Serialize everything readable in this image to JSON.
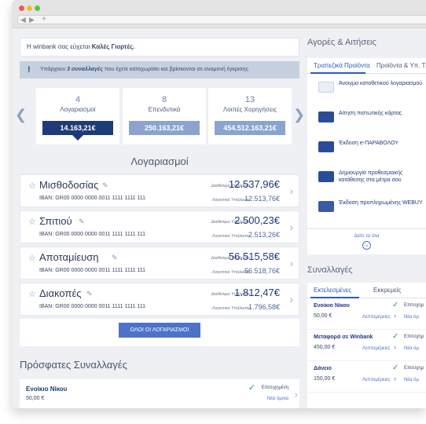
{
  "welcome": {
    "prefix": "Η winbank σας εύχεται ",
    "bold": "Καλές Γιορτές."
  },
  "notice": {
    "icon": "!",
    "before": "Υπάρχουν ",
    "bold": "3 συναλλαγές",
    "after": " που έχετε καταχωρίσει και βρίσκονται σε αναμονή έγκρισης"
  },
  "summary_cards": [
    {
      "count": "4",
      "label": "Λογαριασμοί",
      "value": "14.163,21€",
      "active": true
    },
    {
      "count": "8",
      "label": "Επενδυτικά",
      "value": "250.163,21€",
      "active": false
    },
    {
      "count": "13",
      "label": "Λοιπές Χορηγήσεις",
      "value": "454.512.163,21€",
      "active": false
    }
  ],
  "accounts_title": "Λογαριασμοί",
  "accounts": [
    {
      "name": "Μισθοδοσίας",
      "iban": "IBAN:  GR00 0000 0000 0011 1111 1111 111",
      "available_label": "Διαθέσιμο Υπόλοιπο",
      "available": "12.537,96€",
      "ledger_label": "Λογιστικό Υπόλοιπο",
      "ledger": "12.513,76€"
    },
    {
      "name": "Σπιτιού",
      "iban": "IBAN:  GR00 0000 0000 0011 1111 1111 111",
      "available_label": "Διαθέσιμο Υπόλοιπο",
      "available": "2.500,23€",
      "ledger_label": "Λογιστικό Υπόλοιπο",
      "ledger": "2.513,26€"
    },
    {
      "name": "Αποταμίευση",
      "iban": "IBAN:  GR00 0000 0000 0011 1111 1111 111",
      "available_label": "Διαθέσιμο Υπόλοιπο",
      "available": "56.515,58€",
      "ledger_label": "Λογιστικό Υπόλοιπο",
      "ledger": "56.518,76€"
    },
    {
      "name": "Διακοπές",
      "iban": "IBAN:  GR00 0000 0000 0011 1111 1111 111",
      "available_label": "Διαθέσιμο Υπόλοιπο",
      "available": "1.812,47€",
      "ledger_label": "Λογιστικό Υπόλοιπο",
      "ledger": "1.796,58€"
    }
  ],
  "all_accounts_button": "ΟΛΟΙ ΟΙ ΛΟΓΑΡΙΑΣΜΟΙ",
  "recent": {
    "title": "Πρόσφατες Συναλλαγές",
    "items": [
      {
        "name": "Ενοίκιο Νίκου",
        "amount": "50,00 €",
        "status": "Επιτυχημένη",
        "link": "Νέα όμοια"
      }
    ]
  },
  "purchases": {
    "title": "Αγορές & Αιτήσεις",
    "tabs": [
      "Τραπεζικά Προϊόντα",
      "Προϊόντα & Υπ. Τρίτων"
    ],
    "items": [
      {
        "text": "Άνοιγμα καταθετικού λογαριασμού",
        "icon": "deposit-account-icon",
        "color": "#e9eef6"
      },
      {
        "text": "Αίτηση πιστωτικής κάρτας",
        "icon": "credit-card-icon",
        "color": "#2a4b9a"
      },
      {
        "text": "Έκδοση e-ΠΑΡΑΒΟΛΟΥ",
        "icon": "e-paravolo-icon",
        "color": "#2a4b9a"
      },
      {
        "text": "Δημιουργία προθεσμιακής κατάθεσης στα μέτρα σου",
        "icon": "time-deposit-icon",
        "color": "#2a4b9a"
      },
      {
        "text": "Έκδοση προπληρωμένης WEBUY",
        "icon": "webuy-card-icon",
        "color": "#3a5aa8"
      }
    ],
    "see_all": "Δείτε τα όλα"
  },
  "transactions": {
    "title": "Συναλλαγές",
    "tabs": [
      "Εκτελεσμένες",
      "Εκκρεμείς"
    ],
    "items": [
      {
        "name": "Ενοίκιο Νίκου",
        "amount": "50,00 €",
        "status": "Επιτυχημ",
        "details": "Λεπτομέρειες",
        "new": "Νέα όμ"
      },
      {
        "name": "Μεταφορά σε Winbank",
        "amount": "450,00 €",
        "status": "Επιτυχημ",
        "details": "Λεπτομέρειες",
        "new": "Νέα όμ"
      },
      {
        "name": "Δάνειο",
        "amount": "150,00 €",
        "status": "Επιτυχημ",
        "details": "Λεπτομέρειες",
        "new": "Νέα όμ"
      }
    ]
  }
}
